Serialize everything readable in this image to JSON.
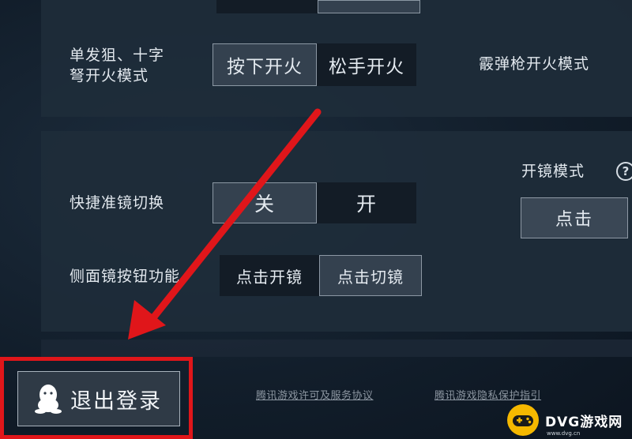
{
  "top_panel": {
    "single_fire": {
      "label": "单发狙、十字\n弩开火模式",
      "options": [
        "按下开火",
        "松手开火"
      ],
      "selected_index": 0
    },
    "shotgun_label": "霰弹枪开火模式"
  },
  "mid_panel": {
    "quick_scope": {
      "label": "快捷准镜切换",
      "options": [
        "关",
        "开"
      ],
      "selected_index": 0
    },
    "side_scope": {
      "label": "侧面镜按钮功能",
      "options": [
        "点击开镜",
        "点击切镜"
      ],
      "selected_index": 1
    },
    "scope_mode": {
      "label": "开镜模式",
      "help_glyph": "?",
      "value": "点击"
    }
  },
  "footer": {
    "logout_label": "退出登录",
    "license_link": "腾讯游戏许可及服务协议",
    "privacy_link": "腾讯游戏隐私保护指引"
  },
  "watermark": {
    "text": "DVG游戏网",
    "sub": "www.dvg.cn"
  },
  "colors": {
    "highlight_red": "#e0161a",
    "selected_bg": "#34414f",
    "unselected_bg": "#131c26"
  }
}
